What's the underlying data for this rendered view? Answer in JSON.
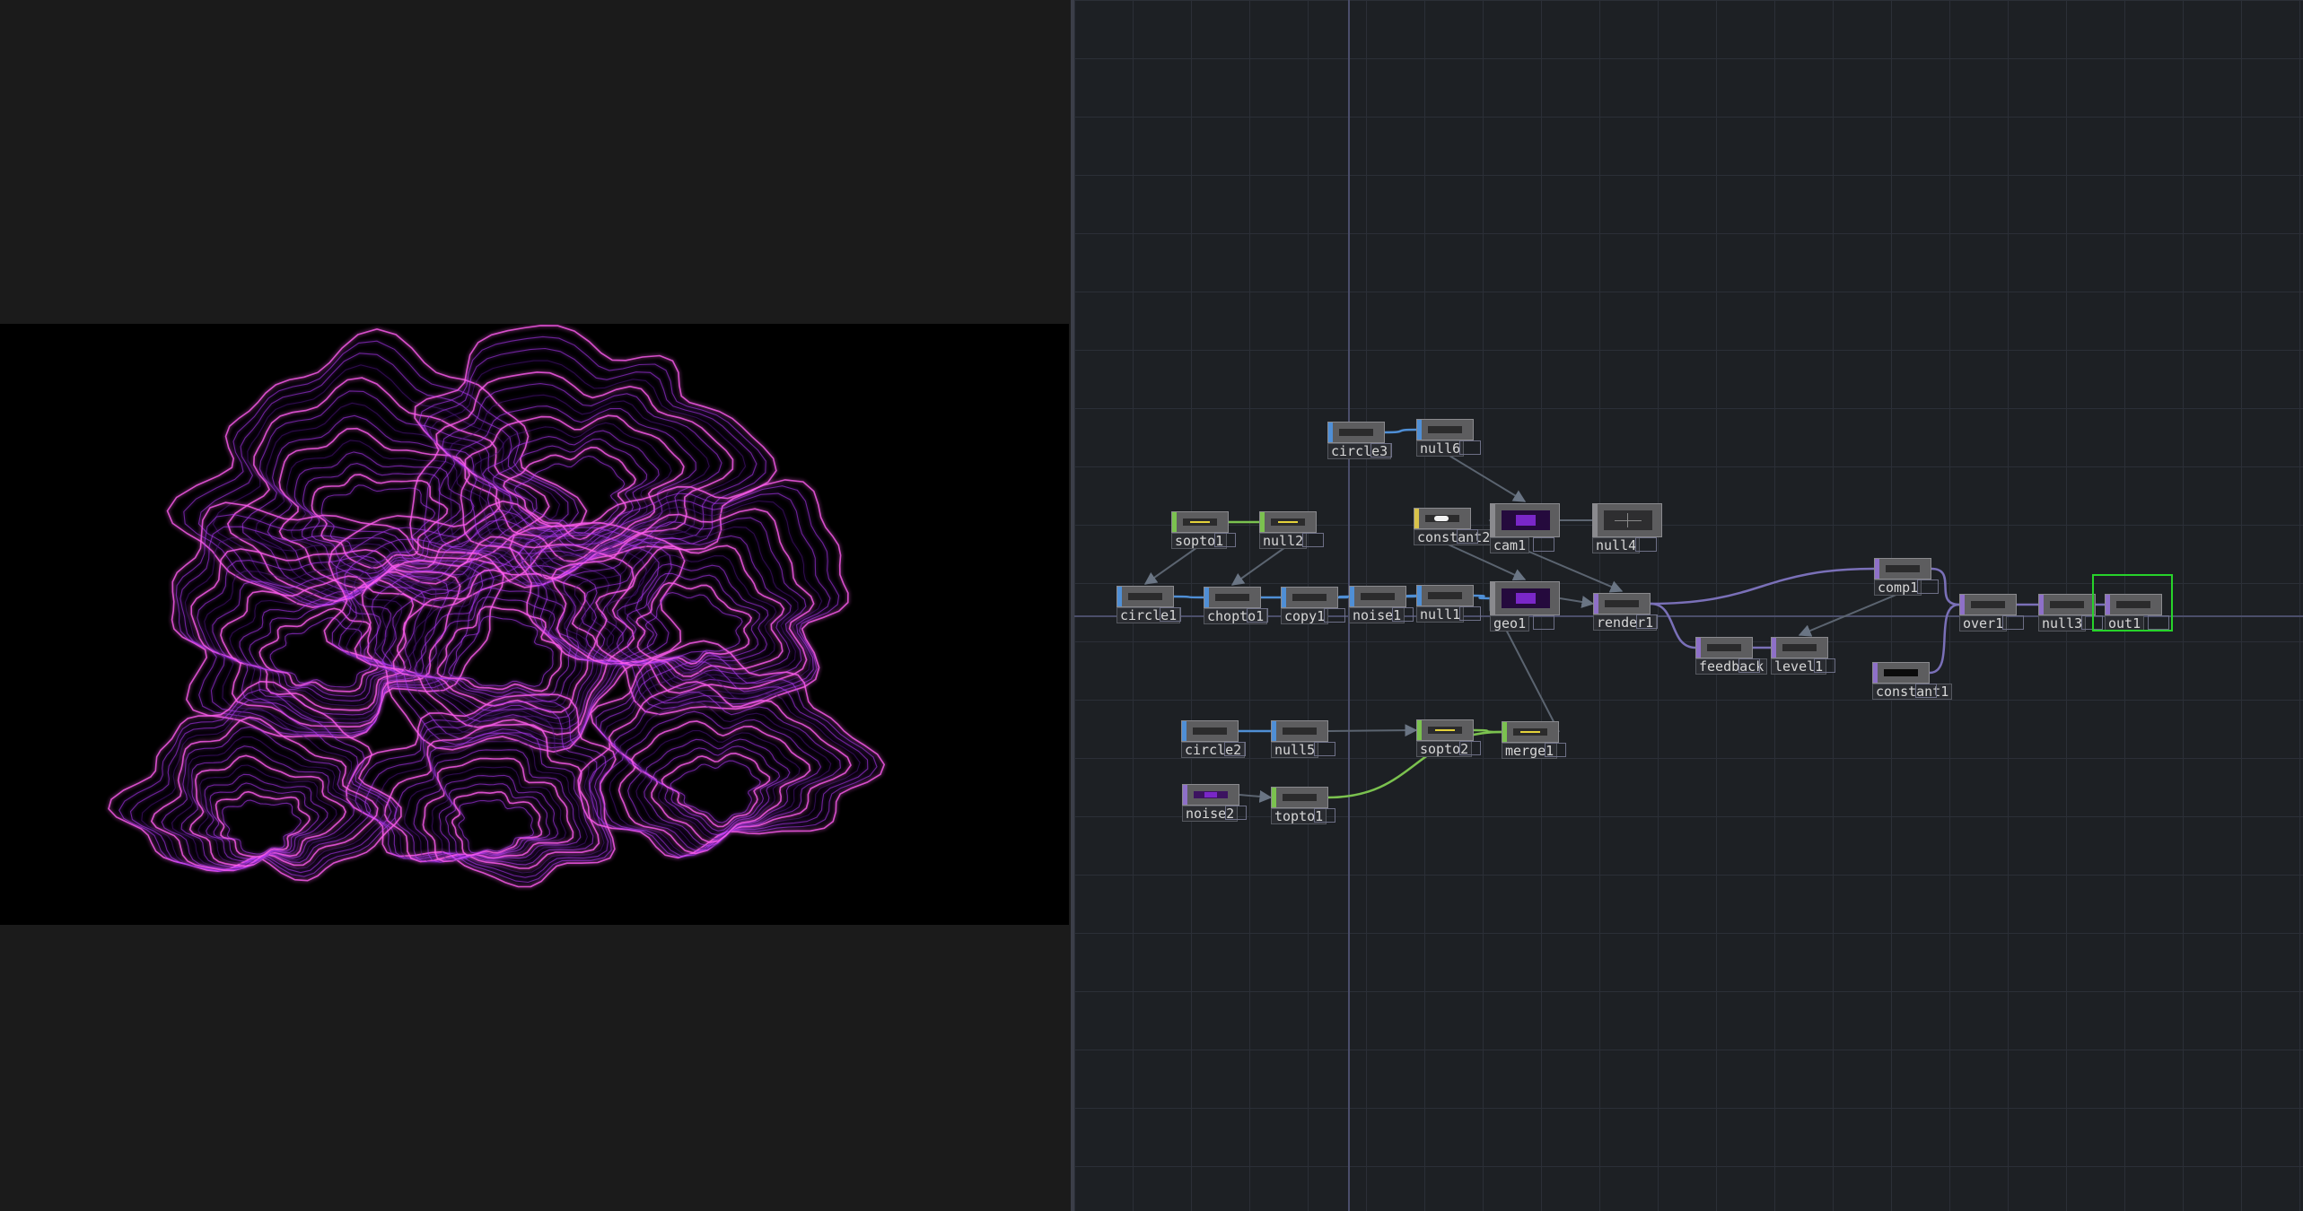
{
  "viewer": {
    "background": "#1b1b1b",
    "render_background": "#000000",
    "content": "purple glowing topographic contour lines",
    "colors": {
      "primary": "#b63bff",
      "highlight": "#ff5cf0",
      "dim": "#4a1a80"
    }
  },
  "network": {
    "background": "#1d2024",
    "grid_color": "#2b2f37",
    "axis_color": "#4b4e6a",
    "nodes": [
      {
        "id": "circle3",
        "label": "circle3",
        "family": "SOP",
        "stripe": "#4f8fd6",
        "thumb": "dark"
      },
      {
        "id": "null6",
        "label": "null6",
        "family": "SOP",
        "stripe": "#4f8fd6",
        "thumb": "dark"
      },
      {
        "id": "sopto1",
        "label": "sopto1",
        "family": "CHOP",
        "stripe": "#7bc24f",
        "thumb": "yellow-line"
      },
      {
        "id": "null2",
        "label": "null2",
        "family": "CHOP",
        "stripe": "#7bc24f",
        "thumb": "yellow-line"
      },
      {
        "id": "constant2",
        "label": "constant2",
        "family": "DAT",
        "stripe": "#d8c24a",
        "thumb": "white"
      },
      {
        "id": "cam1",
        "label": "cam1",
        "family": "COMP",
        "stripe": "#8a8a8e",
        "thumb": "purple",
        "big": true
      },
      {
        "id": "null4",
        "label": "null4",
        "family": "COMP",
        "stripe": "#8a8a8e",
        "thumb": "grid",
        "big": true
      },
      {
        "id": "circle1",
        "label": "circle1",
        "family": "SOP",
        "stripe": "#4f8fd6",
        "thumb": "dark"
      },
      {
        "id": "chopto1",
        "label": "chopto1",
        "family": "SOP",
        "stripe": "#4f8fd6",
        "thumb": "dark"
      },
      {
        "id": "copy1",
        "label": "copy1",
        "family": "SOP",
        "stripe": "#4f8fd6",
        "thumb": "dark"
      },
      {
        "id": "noise1",
        "label": "noise1",
        "family": "SOP",
        "stripe": "#4f8fd6",
        "thumb": "dark"
      },
      {
        "id": "null1",
        "label": "null1",
        "family": "SOP",
        "stripe": "#4f8fd6",
        "thumb": "dark"
      },
      {
        "id": "geo1",
        "label": "geo1",
        "family": "COMP",
        "stripe": "#8a8a8e",
        "thumb": "purple",
        "big": true
      },
      {
        "id": "render1",
        "label": "render1",
        "family": "TOP",
        "stripe": "#8e70c8",
        "thumb": "dark"
      },
      {
        "id": "feedback",
        "label": "feedback",
        "family": "TOP",
        "stripe": "#8e70c8",
        "thumb": "dark"
      },
      {
        "id": "level1",
        "label": "level1",
        "family": "TOP",
        "stripe": "#8e70c8",
        "thumb": "dark"
      },
      {
        "id": "comp1",
        "label": "comp1",
        "family": "TOP",
        "stripe": "#8e70c8",
        "thumb": "dark"
      },
      {
        "id": "over1",
        "label": "over1",
        "family": "TOP",
        "stripe": "#8e70c8",
        "thumb": "dark"
      },
      {
        "id": "null3",
        "label": "null3",
        "family": "TOP",
        "stripe": "#8e70c8",
        "thumb": "dark"
      },
      {
        "id": "out1",
        "label": "out1",
        "family": "TOP",
        "stripe": "#8e70c8",
        "thumb": "dark",
        "selected": true
      },
      {
        "id": "constant1",
        "label": "constant1",
        "family": "TOP",
        "stripe": "#8e70c8",
        "thumb": "black"
      },
      {
        "id": "circle2",
        "label": "circle2",
        "family": "SOP",
        "stripe": "#4f8fd6",
        "thumb": "dark"
      },
      {
        "id": "null5",
        "label": "null5",
        "family": "SOP",
        "stripe": "#4f8fd6",
        "thumb": "dark"
      },
      {
        "id": "sopto2",
        "label": "sopto2",
        "family": "CHOP",
        "stripe": "#7bc24f",
        "thumb": "yellow-line"
      },
      {
        "id": "merge1",
        "label": "merge1",
        "family": "CHOP",
        "stripe": "#7bc24f",
        "thumb": "white-line"
      },
      {
        "id": "noise2",
        "label": "noise2",
        "family": "TOP",
        "stripe": "#8e70c8",
        "thumb": "purple"
      },
      {
        "id": "topto1",
        "label": "topto1",
        "family": "CHOP",
        "stripe": "#7bc24f",
        "thumb": "dark"
      }
    ],
    "connections": [
      {
        "from": "circle3",
        "to": "null6",
        "type": "SOP"
      },
      {
        "from": "null6",
        "to": "cam1",
        "type": "wire-arrow"
      },
      {
        "from": "sopto1",
        "to": "null2",
        "type": "CHOP"
      },
      {
        "from": "sopto1",
        "to": "circle1",
        "type": "wire-arrow"
      },
      {
        "from": "null2",
        "to": "chopto1",
        "type": "wire-arrow"
      },
      {
        "from": "circle1",
        "to": "chopto1",
        "type": "SOP"
      },
      {
        "from": "chopto1",
        "to": "copy1",
        "type": "SOP"
      },
      {
        "from": "copy1",
        "to": "noise1",
        "type": "SOP"
      },
      {
        "from": "noise1",
        "to": "null1",
        "type": "SOP"
      },
      {
        "from": "null1",
        "to": "geo1",
        "type": "SOP"
      },
      {
        "from": "constant2",
        "to": "geo1",
        "type": "wire-arrow"
      },
      {
        "from": "cam1",
        "to": "render1",
        "type": "wire-arrow"
      },
      {
        "from": "null4",
        "to": "cam1",
        "type": "wire-arrow"
      },
      {
        "from": "geo1",
        "to": "render1",
        "type": "wire-arrow"
      },
      {
        "from": "render1",
        "to": "comp1",
        "type": "TOP"
      },
      {
        "from": "render1",
        "to": "feedback",
        "type": "TOP"
      },
      {
        "from": "feedback",
        "to": "level1",
        "type": "TOP"
      },
      {
        "from": "comp1",
        "to": "level1",
        "type": "wire-arrow"
      },
      {
        "from": "comp1",
        "to": "over1",
        "type": "TOP"
      },
      {
        "from": "constant1",
        "to": "over1",
        "type": "TOP"
      },
      {
        "from": "over1",
        "to": "null3",
        "type": "TOP"
      },
      {
        "from": "null3",
        "to": "out1",
        "type": "TOP"
      },
      {
        "from": "circle2",
        "to": "null5",
        "type": "SOP"
      },
      {
        "from": "null5",
        "to": "sopto2",
        "type": "wire-arrow"
      },
      {
        "from": "sopto2",
        "to": "merge1",
        "type": "CHOP"
      },
      {
        "from": "merge1",
        "to": "geo1",
        "type": "wire-arrow"
      },
      {
        "from": "noise2",
        "to": "topto1",
        "type": "wire-arrow"
      },
      {
        "from": "topto1",
        "to": "merge1",
        "type": "CHOP"
      }
    ],
    "wire_colors": {
      "SOP": "#4f8fd6",
      "CHOP": "#7bc24f",
      "TOP": "#7a70b8",
      "wire-arrow": "#5b6470"
    }
  }
}
